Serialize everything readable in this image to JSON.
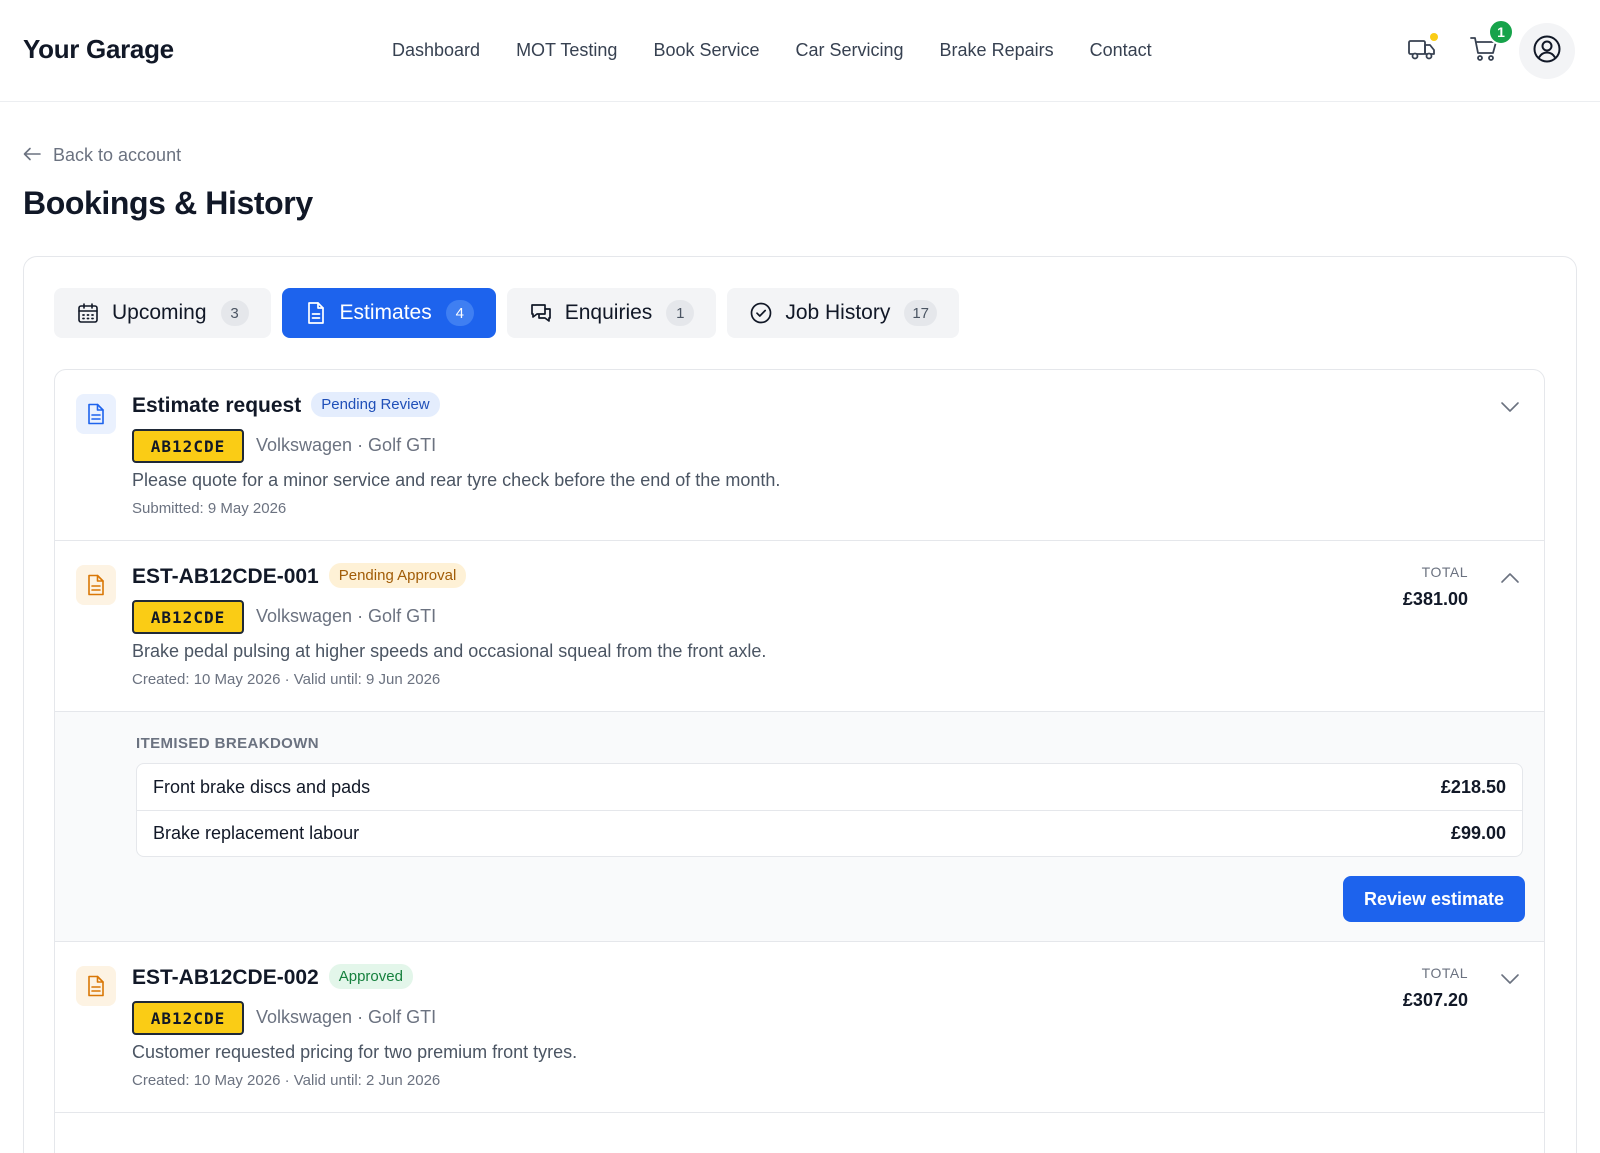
{
  "header": {
    "brand": "Your Garage",
    "nav": [
      "Dashboard",
      "MOT Testing",
      "Book Service",
      "Car Servicing",
      "Brake Repairs",
      "Contact"
    ],
    "cart_count": "1",
    "icons": [
      "truck-icon",
      "cart-icon",
      "user-icon"
    ],
    "truck_dot_color": "#facc15"
  },
  "back_link": "Back to account",
  "page_title": "Bookings & History",
  "tabs": [
    {
      "label": "Upcoming",
      "count": "3",
      "icon": "calendar-icon"
    },
    {
      "label": "Estimates",
      "count": "4",
      "icon": "document-icon",
      "active": true
    },
    {
      "label": "Enquiries",
      "count": "1",
      "icon": "chat-icon"
    },
    {
      "label": "Job History",
      "count": "17",
      "icon": "check-circle-icon"
    }
  ],
  "items": [
    {
      "title": "Estimate request",
      "status": "Pending Review",
      "plate": "AB12CDE",
      "vehicle": "Volkswagen · Golf GTI",
      "description": "Please quote for a minor service and rear tyre check before the end of the month.",
      "meta": "Submitted: 9 May 2026"
    },
    {
      "title": "EST-AB12CDE-001",
      "status": "Pending Approval",
      "plate": "AB12CDE",
      "vehicle": "Volkswagen · Golf GTI",
      "description": "Brake pedal pulsing at higher speeds and occasional squeal from the front axle.",
      "meta": "Created: 10 May 2026 · Valid until: 9 Jun 2026",
      "total_label": "TOTAL",
      "total": "£381.00",
      "expanded": true
    },
    {
      "title": "EST-AB12CDE-002",
      "status": "Approved",
      "plate": "AB12CDE",
      "vehicle": "Volkswagen · Golf GTI",
      "description": "Customer requested pricing for two premium front tyres.",
      "meta": "Created: 10 May 2026 · Valid until: 2 Jun 2026",
      "total_label": "TOTAL",
      "total": "£307.20"
    }
  ],
  "breakdown": {
    "heading": "ITEMISED BREAKDOWN",
    "rows": [
      {
        "label": "Front brake discs and pads",
        "amount": "£218.50"
      },
      {
        "label": "Brake replacement labour",
        "amount": "£99.00"
      }
    ],
    "action": "Review estimate"
  },
  "colors": {
    "primary": "#1d63ed",
    "plate": "#facc15",
    "success": "#16a34a"
  }
}
